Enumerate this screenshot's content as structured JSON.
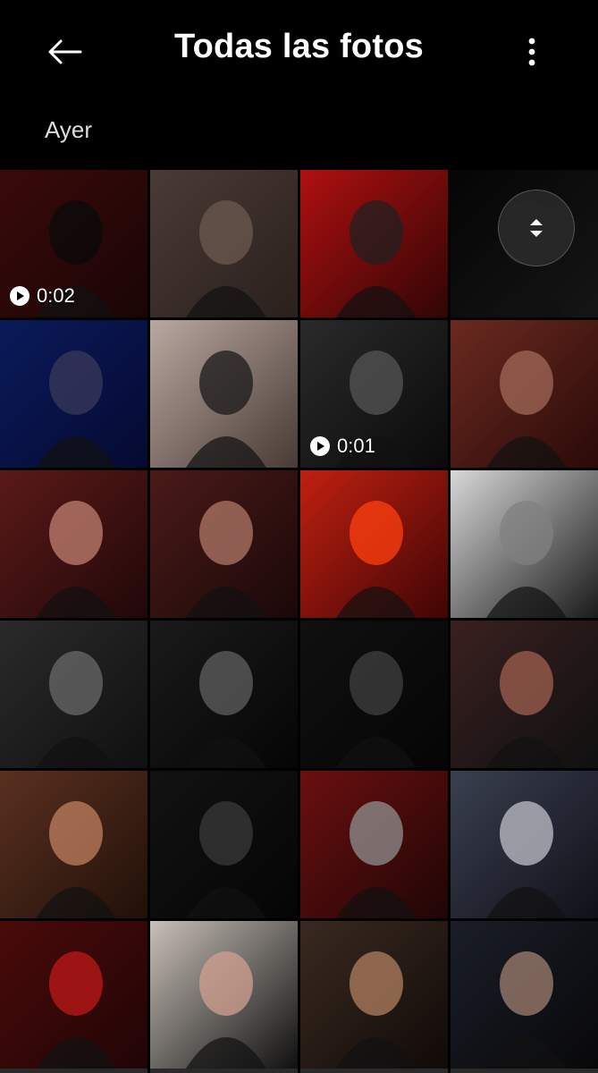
{
  "header": {
    "title": "Todas las fotos",
    "back_icon": "arrow-left-icon",
    "more_icon": "more-vert-icon"
  },
  "section": {
    "label": "Ayer"
  },
  "scroll_handle": {
    "icon": "unfold-arrows-icon"
  },
  "colors": {
    "background": "#000000",
    "text": "#ffffff",
    "secondary_text": "#dddddd"
  },
  "photos": [
    {
      "video": true,
      "duration": "0:02"
    },
    {
      "video": false,
      "duration": ""
    },
    {
      "video": false,
      "duration": ""
    },
    {
      "video": false,
      "duration": ""
    },
    {
      "video": false,
      "duration": ""
    },
    {
      "video": false,
      "duration": ""
    },
    {
      "video": true,
      "duration": "0:01"
    },
    {
      "video": false,
      "duration": ""
    },
    {
      "video": false,
      "duration": ""
    },
    {
      "video": false,
      "duration": ""
    },
    {
      "video": false,
      "duration": ""
    },
    {
      "video": false,
      "duration": ""
    },
    {
      "video": false,
      "duration": ""
    },
    {
      "video": false,
      "duration": ""
    },
    {
      "video": false,
      "duration": ""
    },
    {
      "video": false,
      "duration": ""
    },
    {
      "video": false,
      "duration": ""
    },
    {
      "video": false,
      "duration": ""
    },
    {
      "video": false,
      "duration": ""
    },
    {
      "video": false,
      "duration": ""
    },
    {
      "video": false,
      "duration": ""
    },
    {
      "video": false,
      "duration": ""
    },
    {
      "video": false,
      "duration": ""
    },
    {
      "video": false,
      "duration": ""
    }
  ]
}
